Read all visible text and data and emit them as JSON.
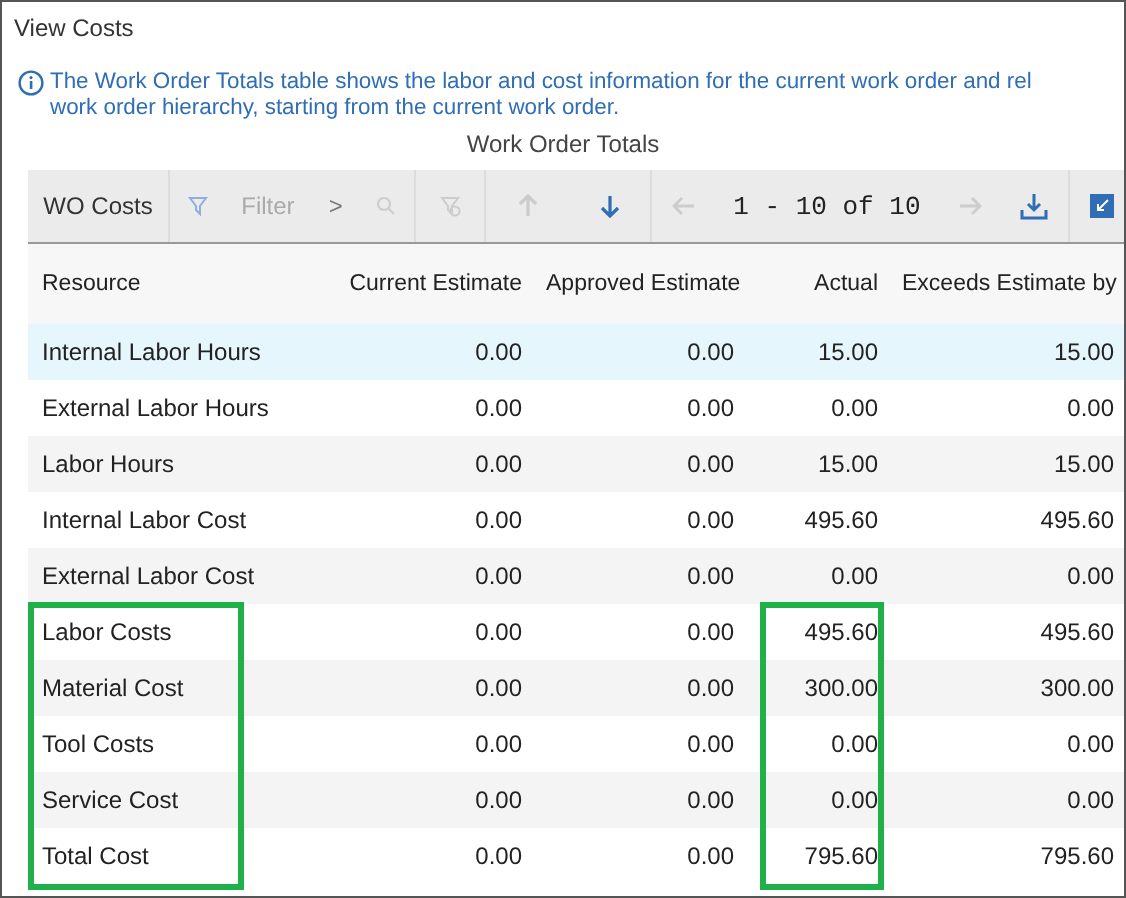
{
  "title": "View Costs",
  "info": [
    "The Work Order Totals table shows the labor and cost information for the current work order and rel",
    "work order hierarchy, starting from the current work order."
  ],
  "table_title": "Work Order Totals",
  "toolbar": {
    "label": "WO Costs",
    "filter_placeholder": "Filter",
    "filter_expand": ">",
    "pagination": "1 - 10 of 10"
  },
  "columns": [
    {
      "label": "Resource",
      "highlighted": true
    },
    {
      "label": "Current Estimate",
      "highlighted": false
    },
    {
      "label": "Approved Estimate",
      "highlighted": false
    },
    {
      "label": "Actual",
      "highlighted": true
    },
    {
      "label": "Exceeds Estimate by",
      "highlighted": false
    }
  ],
  "rows": [
    {
      "cells": [
        "Internal Labor Hours",
        "0.00",
        "0.00",
        "15.00",
        "15.00"
      ],
      "selected": true,
      "highlighted": false
    },
    {
      "cells": [
        "External Labor Hours",
        "0.00",
        "0.00",
        "0.00",
        "0.00"
      ],
      "selected": false,
      "highlighted": false
    },
    {
      "cells": [
        "Labor Hours",
        "0.00",
        "0.00",
        "15.00",
        "15.00"
      ],
      "selected": false,
      "highlighted": false
    },
    {
      "cells": [
        "Internal Labor Cost",
        "0.00",
        "0.00",
        "495.60",
        "495.60"
      ],
      "selected": false,
      "highlighted": false
    },
    {
      "cells": [
        "External Labor Cost",
        "0.00",
        "0.00",
        "0.00",
        "0.00"
      ],
      "selected": false,
      "highlighted": false
    },
    {
      "cells": [
        "Labor Costs",
        "0.00",
        "0.00",
        "495.60",
        "495.60"
      ],
      "selected": false,
      "highlighted": true
    },
    {
      "cells": [
        "Material Cost",
        "0.00",
        "0.00",
        "300.00",
        "300.00"
      ],
      "selected": false,
      "highlighted": true
    },
    {
      "cells": [
        "Tool Costs",
        "0.00",
        "0.00",
        "0.00",
        "0.00"
      ],
      "selected": false,
      "highlighted": true
    },
    {
      "cells": [
        "Service Cost",
        "0.00",
        "0.00",
        "0.00",
        "0.00"
      ],
      "selected": false,
      "highlighted": true
    },
    {
      "cells": [
        "Total Cost",
        "0.00",
        "0.00",
        "795.60",
        "795.60"
      ],
      "selected": false,
      "highlighted": true
    }
  ]
}
